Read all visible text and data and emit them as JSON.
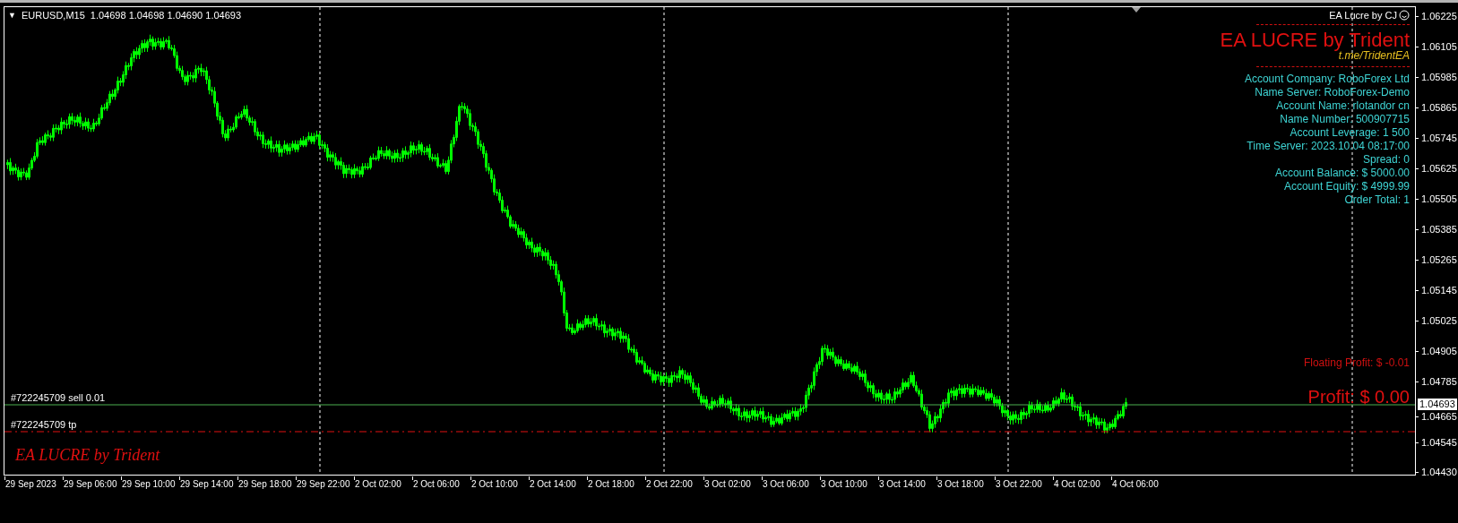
{
  "chart_header": {
    "menu_glyph": "▼",
    "symbol": "EURUSD,M15",
    "ohlc": "1.04698 1.04698 1.04690 1.04693"
  },
  "ea_badge": "EA Lucre by CJ",
  "info_panel": {
    "title": "EA LUCRE by Trident",
    "link": "t.me/TridentEA",
    "lines": [
      "Account Company: RoboForex Ltd",
      "Name Server: RoboForex-Demo",
      "Account Name: rlotandor cn",
      "Name Number: 500907715",
      "Account Leverage: 1 500",
      "Time Server: 2023.10.04 08:17:00",
      "Spread: 0",
      "Account Balance: $ 5000.00",
      "Account Equity: $ 4999.99",
      "Order Total: 1"
    ]
  },
  "floating_profit": "Floating Profit: $ -0.01",
  "profit": "Profit: $ 0.00",
  "order_lines": [
    {
      "kind": "entry",
      "label": "#722245709 sell 0.01"
    },
    {
      "kind": "take_profit",
      "label": "#722245709 tp"
    }
  ],
  "chart_watermark": "EA LUCRE by Trident",
  "price_axis": {
    "ticks": [
      "1.06225",
      "1.06105",
      "1.05985",
      "1.05865",
      "1.05745",
      "1.05625",
      "1.05505",
      "1.05385",
      "1.05265",
      "1.05145",
      "1.05025",
      "1.04905",
      "1.04785",
      "1.04665",
      "1.04545",
      "1.04430"
    ],
    "current_price": "1.04693"
  },
  "time_axis": {
    "labels": [
      "29 Sep 2023",
      "29 Sep 06:00",
      "29 Sep 10:00",
      "29 Sep 14:00",
      "29 Sep 18:00",
      "29 Sep 22:00",
      "2 Oct 02:00",
      "2 Oct 06:00",
      "2 Oct 10:00",
      "2 Oct 14:00",
      "2 Oct 18:00",
      "2 Oct 22:00",
      "3 Oct 02:00",
      "3 Oct 06:00",
      "3 Oct 10:00",
      "3 Oct 14:00",
      "3 Oct 18:00",
      "3 Oct 22:00",
      "4 Oct 02:00",
      "4 Oct 06:00"
    ]
  }
}
